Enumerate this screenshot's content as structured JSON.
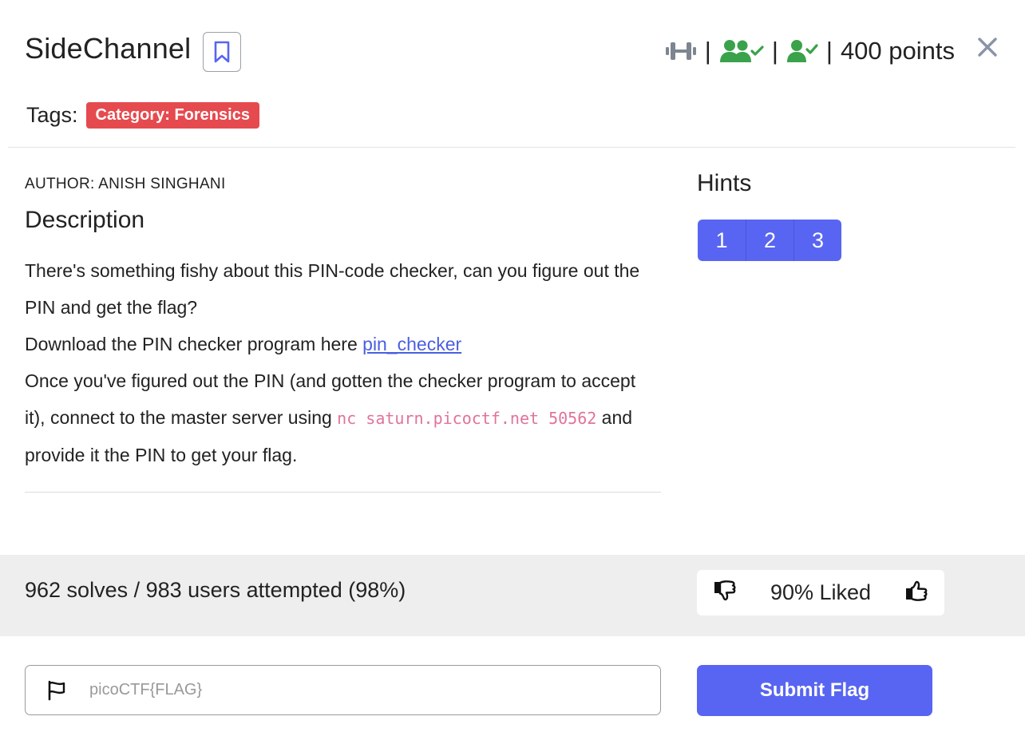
{
  "challenge": {
    "title": "SideChannel",
    "points": "400 points",
    "separators": [
      "|",
      "|",
      "|"
    ]
  },
  "tags": {
    "label": "Tags:",
    "items": [
      "Category: Forensics"
    ]
  },
  "author": "AUTHOR: ANISH SINGHANI",
  "description": {
    "heading": "Description",
    "line1": "There's something fishy about this PIN-code checker, can you figure out the PIN and get the flag?",
    "line2_prefix": "Download the PIN checker program here ",
    "line2_link": "pin_checker",
    "line3_prefix": "Once you've figured out the PIN (and gotten the checker program to accept it), connect to the master server using ",
    "line3_code": "nc saturn.picoctf.net 50562",
    "line3_suffix": " and provide it the PIN to get your flag."
  },
  "hints": {
    "heading": "Hints",
    "buttons": [
      "1",
      "2",
      "3"
    ]
  },
  "stats": {
    "solves": "962 solves / 983 users attempted (98%)",
    "liked": "90% Liked"
  },
  "flag_form": {
    "placeholder": "picoCTF{FLAG}",
    "value": "",
    "submit_label": "Submit Flag"
  },
  "icons": [
    "bookmark-icon",
    "difficulty-dumbbell-icon",
    "users-check-icon",
    "user-check-icon",
    "close-icon",
    "thumbs-down-icon",
    "thumbs-up-icon",
    "flag-icon"
  ],
  "colors": {
    "accent": "#5865f2",
    "tag_red": "#e54a4f",
    "link": "#4a5fe0",
    "code": "#e0739b",
    "success_green": "#3aa24a",
    "icon_gray": "#7d8590"
  }
}
